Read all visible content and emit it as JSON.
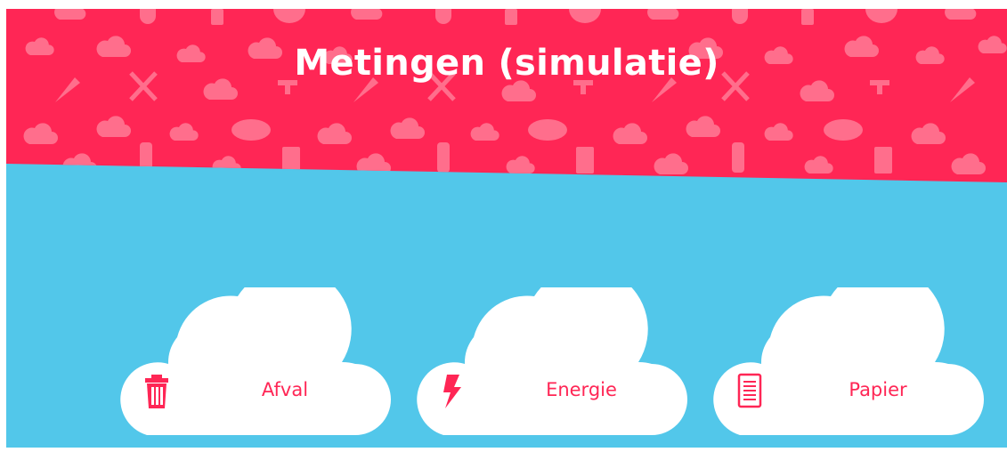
{
  "page": {
    "title": "Metingen (simulatie)"
  },
  "colors": {
    "header_red": "#ff2655",
    "pattern_pink": "#ff6e8c",
    "sky_blue": "#52c7ea",
    "cloud_white": "#ffffff",
    "accent": "#ff2655"
  },
  "header_pattern_icons": [
    "co2-icon",
    "cloud-icon",
    "carrot-icon",
    "fork-knife-icon",
    "tap-icon",
    "bread-icon",
    "bottle-icon",
    "juice-carton-icon",
    "apple-icon",
    "bowl-icon"
  ],
  "categories": [
    {
      "label": "Afval",
      "icon": "trash-icon"
    },
    {
      "label": "Energie",
      "icon": "lightning-icon"
    },
    {
      "label": "Papier",
      "icon": "document-icon"
    }
  ]
}
